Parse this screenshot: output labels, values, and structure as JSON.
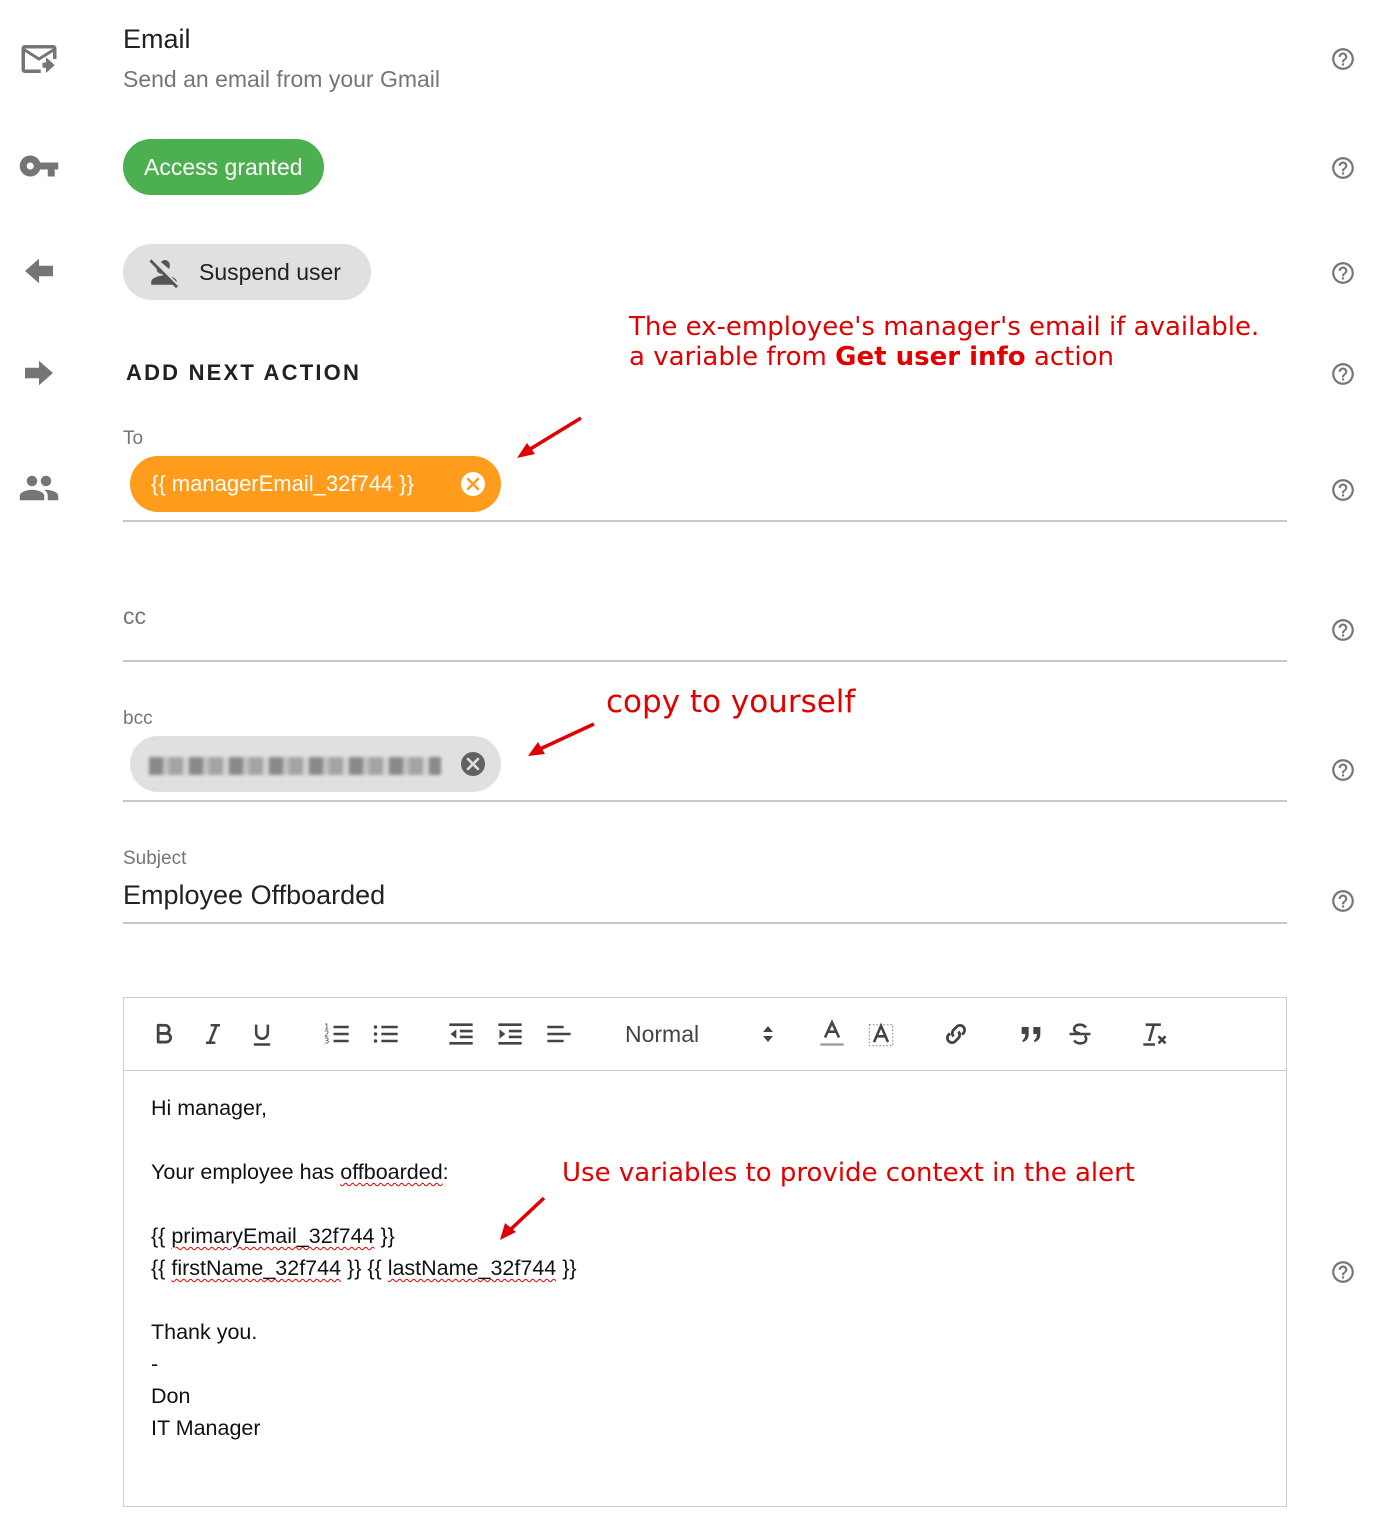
{
  "header": {
    "title": "Email",
    "subtitle": "Send an email from your Gmail"
  },
  "access": {
    "label": "Access granted"
  },
  "previous_action": {
    "label": "Suspend user"
  },
  "next_action": {
    "label": "ADD NEXT ACTION"
  },
  "fields": {
    "to": {
      "label": "To",
      "chip": "{{ managerEmail_32f744 }}"
    },
    "cc": {
      "label": "cc"
    },
    "bcc": {
      "label": "bcc"
    },
    "subject": {
      "label": "Subject",
      "value": "Employee Offboarded"
    }
  },
  "editor": {
    "font_size_option": "Normal",
    "body": {
      "greeting": "Hi manager,",
      "intro_prefix": "Your employee has ",
      "intro_word": "offboarded",
      "intro_suffix": ":",
      "l1_a": "{{ ",
      "l1_b": "primaryEmail_32f744",
      "l1_c": " }}",
      "l2_a": "{{ ",
      "l2_b": "firstName_32f744",
      "l2_c": " }} {{ ",
      "l2_d": "lastName_32f744",
      "l2_e": " }}",
      "thanks": "Thank you.",
      "dash": "-",
      "name": "Don",
      "role": "IT Manager"
    }
  },
  "annotations": {
    "manager_line1": "The ex-employee's manager's email if available.",
    "manager_line2_prefix": "a variable from ",
    "manager_line2_bold": "Get user info",
    "manager_line2_suffix": " action",
    "copy": "copy to yourself",
    "variables": "Use variables to provide context in the alert"
  },
  "colors": {
    "accent_green": "#4caf50",
    "chip_orange": "#ff9c1c",
    "annotation_red": "#e00000"
  }
}
